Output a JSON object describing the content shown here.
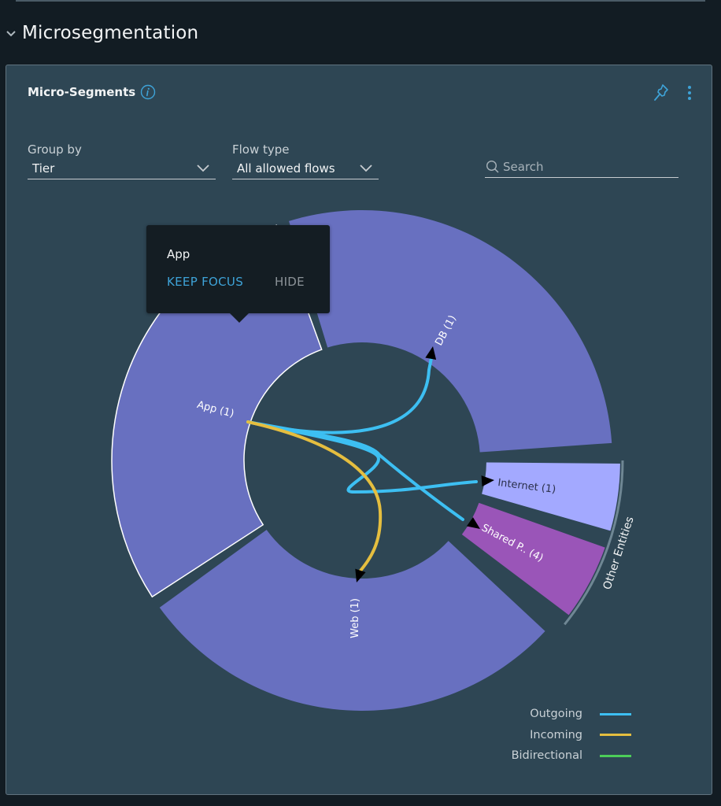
{
  "section": {
    "title": "Microsegmentation",
    "collapse_icon": "chevron-down-icon"
  },
  "card": {
    "title": "Micro-Segments",
    "info_icon": "info-icon",
    "pin_icon": "pin-icon",
    "more_icon": "vertical-ellipsis-icon"
  },
  "controls": {
    "group_by": {
      "label": "Group by",
      "value": "Tier"
    },
    "flow_type": {
      "label": "Flow type",
      "value": "All allowed flows"
    },
    "search": {
      "placeholder": "Search",
      "value": ""
    }
  },
  "tooltip": {
    "title": "App",
    "keep_focus": "KEEP FOCUS",
    "hide": "HIDE"
  },
  "colors": {
    "tier": "#6870c0",
    "internet": "#a3a9ff",
    "shared": "#9a55b8",
    "outgoing": "#3dbff2",
    "incoming": "#e5be3f",
    "bidirectional": "#4ccd59"
  },
  "segments": [
    {
      "id": "db",
      "label": "DB (1)",
      "group": "tier",
      "selected": false
    },
    {
      "id": "internet",
      "label": "Internet (1)",
      "group": "other",
      "selected": false
    },
    {
      "id": "shared",
      "label": "Shared P.. (4)",
      "group": "other",
      "selected": false
    },
    {
      "id": "web",
      "label": "Web (1)",
      "group": "tier",
      "selected": false
    },
    {
      "id": "app",
      "label": "App (1)",
      "group": "tier",
      "selected": true
    }
  ],
  "group_labels": {
    "other": "Other Entities"
  },
  "flows": [
    {
      "from": "app",
      "to": "db",
      "type": "outgoing"
    },
    {
      "from": "app",
      "to": "internet",
      "type": "outgoing"
    },
    {
      "from": "app",
      "to": "shared",
      "type": "outgoing"
    },
    {
      "from": "app",
      "to": "web",
      "type": "incoming"
    }
  ],
  "legend": [
    {
      "label": "Outgoing",
      "key": "outgoing"
    },
    {
      "label": "Incoming",
      "key": "incoming"
    },
    {
      "label": "Bidirectional",
      "key": "bidirectional"
    }
  ]
}
